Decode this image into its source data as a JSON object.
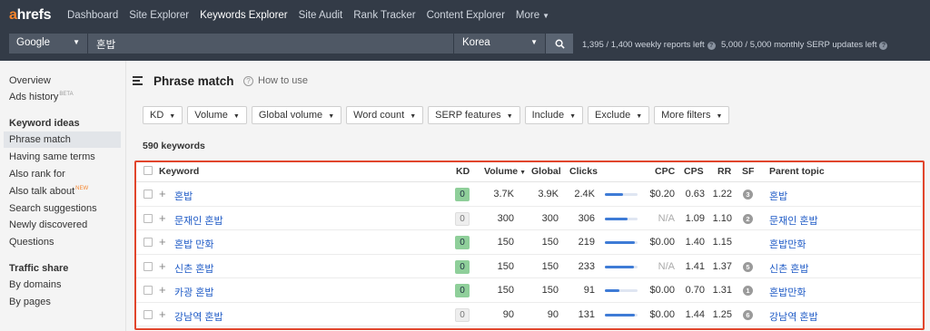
{
  "nav": {
    "logo_a": "a",
    "logo_rest": "hrefs",
    "items": [
      "Dashboard",
      "Site Explorer",
      "Keywords Explorer",
      "Site Audit",
      "Rank Tracker",
      "Content Explorer",
      "More"
    ],
    "active": "Keywords Explorer"
  },
  "search": {
    "engine": "Google",
    "query": "혼밥",
    "country": "Korea",
    "reports_left": "1,395 / 1,400 weekly reports left",
    "serp_updates_left": "5,000 / 5,000 monthly SERP updates left"
  },
  "sidebar": {
    "overview": "Overview",
    "ads_history": "Ads history",
    "ads_badge": "BETA",
    "keyword_ideas_heading": "Keyword ideas",
    "phrase_match": "Phrase match",
    "having_same_terms": "Having same terms",
    "also_rank_for": "Also rank for",
    "also_talk_about": "Also talk about",
    "also_talk_badge": "NEW",
    "search_suggestions": "Search suggestions",
    "newly_discovered": "Newly discovered",
    "questions": "Questions",
    "traffic_share_heading": "Traffic share",
    "by_domains": "By domains",
    "by_pages": "By pages"
  },
  "main": {
    "title": "Phrase match",
    "how_to_use": "How to use",
    "filters": [
      "KD",
      "Volume",
      "Global volume",
      "Word count",
      "SERP features",
      "Include",
      "Exclude",
      "More filters"
    ],
    "keyword_count": "590 keywords"
  },
  "table": {
    "headers": {
      "keyword": "Keyword",
      "kd": "KD",
      "volume": "Volume",
      "global": "Global",
      "clicks": "Clicks",
      "cpc": "CPC",
      "cps": "CPS",
      "rr": "RR",
      "sf": "SF",
      "parent_topic": "Parent topic"
    },
    "rows": [
      {
        "keyword": "혼밥",
        "kd": "0",
        "kd_color": "green",
        "volume": "3.7K",
        "global": "3.9K",
        "clicks": "2.4K",
        "clicks_fill": 0.55,
        "cpc": "$0.20",
        "cpc_muted": false,
        "cps": "0.63",
        "rr": "1.22",
        "sf": "3",
        "parent_topic": "혼밥"
      },
      {
        "keyword": "문재인 혼밥",
        "kd": "0",
        "kd_color": "grey",
        "volume": "300",
        "global": "300",
        "clicks": "306",
        "clicks_fill": 0.7,
        "cpc": "N/A",
        "cpc_muted": true,
        "cps": "1.09",
        "rr": "1.10",
        "sf": "2",
        "parent_topic": "문재인 혼밥"
      },
      {
        "keyword": "혼밥 만화",
        "kd": "0",
        "kd_color": "green",
        "volume": "150",
        "global": "150",
        "clicks": "219",
        "clicks_fill": 0.92,
        "cpc": "$0.00",
        "cpc_muted": false,
        "cps": "1.40",
        "rr": "1.15",
        "sf": "",
        "parent_topic": "혼밥만화"
      },
      {
        "keyword": "신촌 혼밥",
        "kd": "0",
        "kd_color": "green",
        "volume": "150",
        "global": "150",
        "clicks": "233",
        "clicks_fill": 0.9,
        "cpc": "N/A",
        "cpc_muted": true,
        "cps": "1.41",
        "rr": "1.37",
        "sf": "5",
        "parent_topic": "신촌 혼밥"
      },
      {
        "keyword": "카광 혼밥",
        "kd": "0",
        "kd_color": "green",
        "volume": "150",
        "global": "150",
        "clicks": "91",
        "clicks_fill": 0.45,
        "cpc": "$0.00",
        "cpc_muted": false,
        "cps": "0.70",
        "rr": "1.31",
        "sf": "1",
        "parent_topic": "혼밥만화"
      },
      {
        "keyword": "강남역 혼밥",
        "kd": "0",
        "kd_color": "grey",
        "volume": "90",
        "global": "90",
        "clicks": "131",
        "clicks_fill": 0.92,
        "cpc": "$0.00",
        "cpc_muted": false,
        "cps": "1.44",
        "rr": "1.25",
        "sf": "6",
        "parent_topic": "강남역 혼밥"
      }
    ]
  },
  "colors": {
    "nav_bg": "#333b47",
    "accent_orange": "#f5842b",
    "link_blue": "#1f5bc6",
    "kd_green": "#8fcf9a",
    "bar_blue": "#3e7bd6",
    "highlight_red": "#e1452c"
  }
}
